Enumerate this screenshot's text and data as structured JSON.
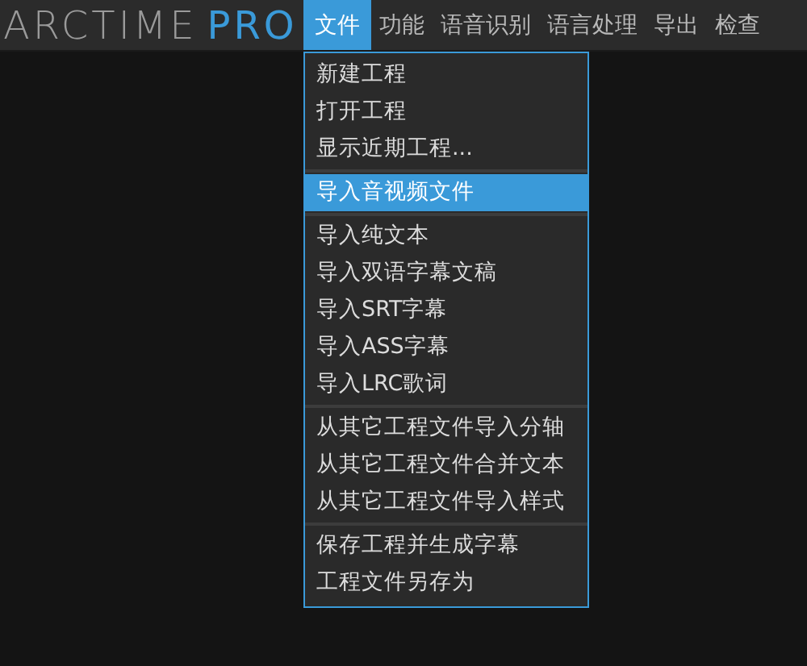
{
  "logo": {
    "name": "ARCTIME",
    "edition": "PRO"
  },
  "menubar": [
    {
      "label": "文件",
      "selected": true
    },
    {
      "label": "功能",
      "selected": false
    },
    {
      "label": "语音识别",
      "selected": false
    },
    {
      "label": "语言处理",
      "selected": false
    },
    {
      "label": "导出",
      "selected": false
    },
    {
      "label": "检查",
      "selected": false
    }
  ],
  "menu": {
    "groups": [
      [
        {
          "label": "新建工程",
          "selected": false
        },
        {
          "label": "打开工程",
          "selected": false
        },
        {
          "label": "显示近期工程...",
          "selected": false
        }
      ],
      [
        {
          "label": "导入音视频文件",
          "selected": true
        }
      ],
      [
        {
          "label": "导入纯文本",
          "selected": false
        },
        {
          "label": "导入双语字幕文稿",
          "selected": false
        },
        {
          "label": "导入SRT字幕",
          "selected": false
        },
        {
          "label": "导入ASS字幕",
          "selected": false
        },
        {
          "label": "导入LRC歌词",
          "selected": false
        }
      ],
      [
        {
          "label": "从其它工程文件导入分轴",
          "selected": false
        },
        {
          "label": "从其它工程文件合并文本",
          "selected": false
        },
        {
          "label": "从其它工程文件导入样式",
          "selected": false
        }
      ],
      [
        {
          "label": "保存工程并生成字幕",
          "selected": false
        },
        {
          "label": "工程文件另存为",
          "selected": false
        }
      ]
    ]
  }
}
